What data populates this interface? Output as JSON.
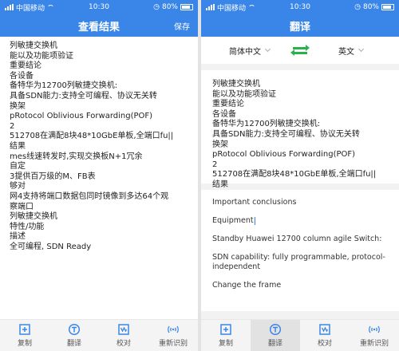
{
  "status": {
    "carrier": "中国移动",
    "time": "10:30",
    "battery": "80%"
  },
  "left": {
    "title": "查看结果",
    "action_label": "保存",
    "lines": [
      "列敏捷交换机",
      "能以及功能项验证",
      "重要结论",
      "各设备",
      "备特华为12700列敏捷交换机:",
      "具备SDN能力:支持全可编程、协议无关转",
      "换架",
      "pRotocol Oblivious Forwarding(POF)",
      "2",
      "512708在满配8块48*10GbE单板,全端口fu||",
      "结果",
      "mes线速转发时,实现交换板N+1冗余",
      "自定",
      "3提供百万级的M、FB表",
      "够对",
      "网4支持将端口数据包同时镜像到多达64个观",
      "察端口",
      "列敏捷交换机",
      "特性/功能",
      "描述",
      "全可编程, SDN Ready"
    ]
  },
  "right": {
    "title": "翻译",
    "source_lang": "简体中文",
    "target_lang": "英文",
    "source_lines": [
      "列敏捷交换机",
      "能以及功能项验证",
      "重要结论",
      "各设备",
      "备特华为12700列敏捷交换机:",
      "具备SDN能力:支持全可编程、协议无关转",
      "换架",
      "pRotocol Oblivious Forwarding(POF)",
      "2",
      "512708在满配8块48*10GbE单板,全端口fu||",
      "结果"
    ],
    "translated_lines": [
      "Important conclusions",
      "Equipment",
      "Standby Huawei 12700 column agile Switch:",
      "SDN capability: fully programmable, protocol-independent",
      "Change the frame"
    ]
  },
  "toolbar": {
    "items": [
      {
        "label": "复制",
        "icon": "copy-icon"
      },
      {
        "label": "翻译",
        "icon": "translate-icon"
      },
      {
        "label": "校对",
        "icon": "proofread-icon"
      },
      {
        "label": "重新识别",
        "icon": "rescan-icon"
      }
    ]
  },
  "colors": {
    "accent": "#3a86e8",
    "swap": "#27b24a"
  }
}
